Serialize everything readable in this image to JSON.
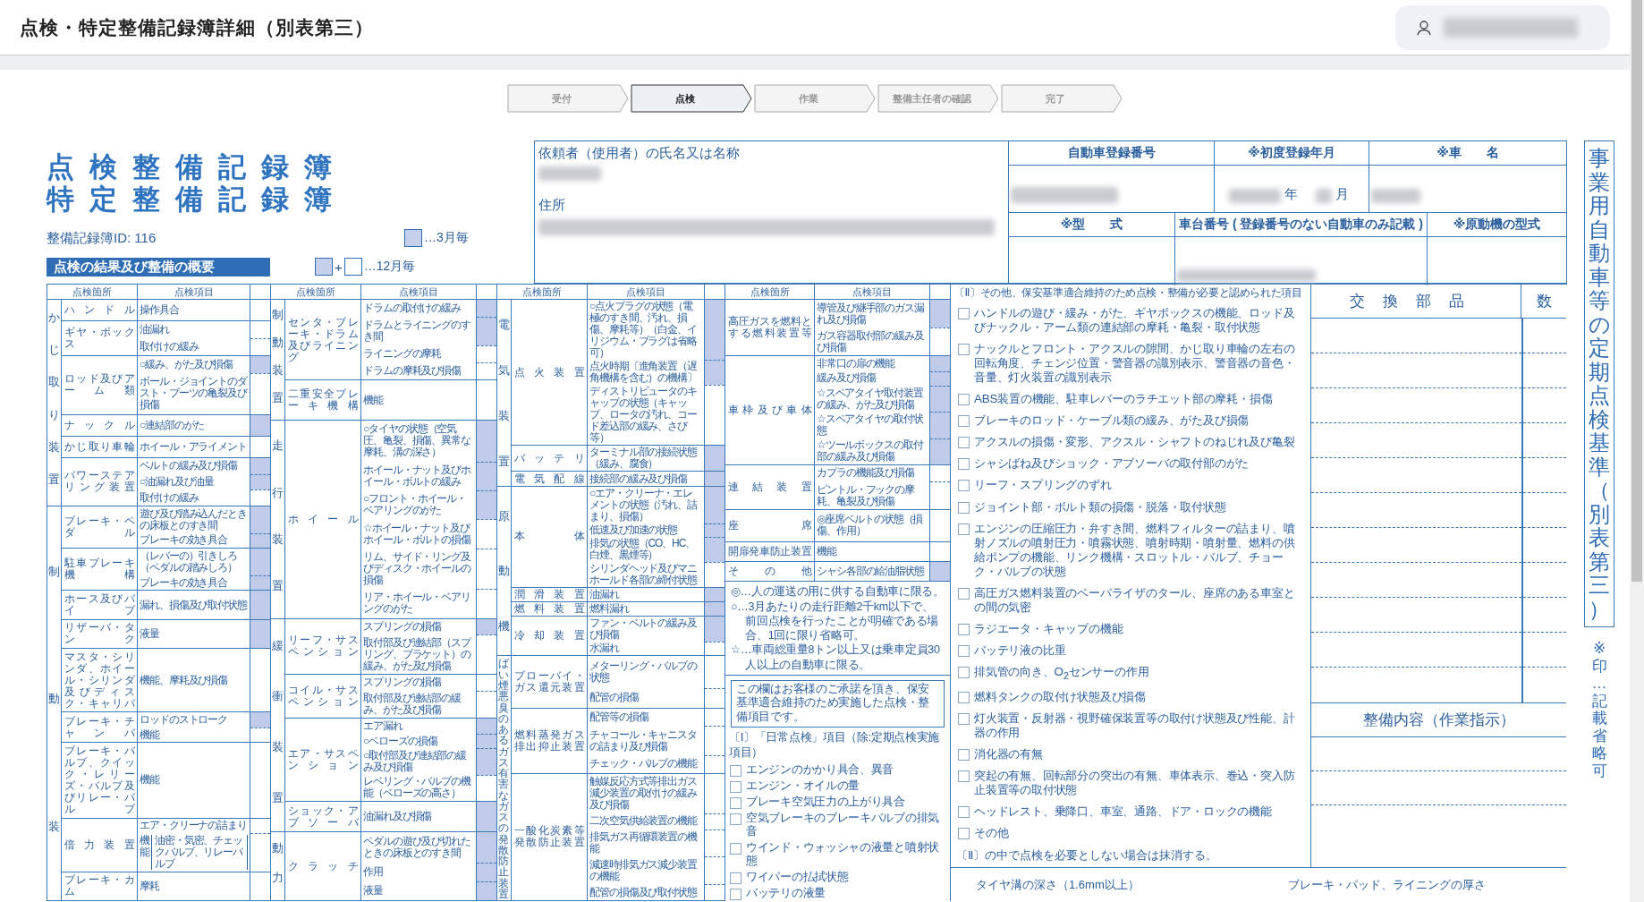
{
  "header": {
    "title": "点検・特定整備記録簿詳細（別表第三）"
  },
  "steps": [
    {
      "label": "受付",
      "selected": false
    },
    {
      "label": "点検",
      "selected": true
    },
    {
      "label": "作業",
      "selected": false
    },
    {
      "label": "整備主任者の確認",
      "selected": false
    },
    {
      "label": "完了",
      "selected": false
    }
  ],
  "form": {
    "titles": [
      "点検整備記録簿",
      "特定整備記録簿"
    ],
    "record_id": "整備記録簿ID: 116",
    "summary_label": "点検の結果及び整備の概要",
    "legend": [
      {
        "kind": "three_month",
        "text": "…3月毎"
      },
      {
        "kind": "twelve_month",
        "plus": "+",
        "text": "…12月毎"
      }
    ],
    "client": {
      "name_label": "依頼者（使用者）の氏名又は名称",
      "address_label": "住所"
    },
    "vehicle": {
      "registration_label": "自動車登録番号",
      "first_registration_label": "※初度登録年月",
      "year": "年",
      "month": "月",
      "car_name_label": "※車　　名",
      "model_label": "※型　　式",
      "chassis_label": "車台番号 ( 登録番号のない自動車のみ記載 )",
      "engine_label": "※原動機の型式"
    },
    "side_title": "事業用自動車等の定期点検基準（別表第三）",
    "side_note": "※印…記載省略可"
  },
  "inspection": {
    "columns": [
      {
        "headers": [
          "点検箇所",
          "点検項目"
        ],
        "categories": [
          {
            "label": "かじ取り装置",
            "parts": [
              {
                "name": "ハンドル",
                "items": [
                  {
                    "text": "操作具合",
                    "shaded": false
                  }
                ]
              },
              {
                "name": "ギヤ・ボックス",
                "items": [
                  {
                    "text": "油漏れ",
                    "shaded": false
                  },
                  {
                    "text": "取付けの緩み",
                    "shaded": false
                  }
                ]
              },
              {
                "name": "ロッド及びアーム類",
                "items": [
                  {
                    "text": "○緩み、がた及び損傷",
                    "shaded": true
                  },
                  {
                    "text": "ボール・ジョイントのダスト・ブーツの亀裂及び損傷",
                    "shaded": false
                  }
                ]
              },
              {
                "name": "ナックル",
                "items": [
                  {
                    "text": "○連結部のがた",
                    "shaded": true
                  }
                ]
              },
              {
                "name": "かじ取り車輪",
                "items": [
                  {
                    "text": "ホイール・アライメント",
                    "shaded": false
                  }
                ]
              },
              {
                "name": "パワーステアリング装置",
                "items": [
                  {
                    "text": "ベルトの緩み及び損傷",
                    "shaded": true
                  },
                  {
                    "text": "○油漏れ及び油量",
                    "shaded": true
                  },
                  {
                    "text": "取付けの緩み",
                    "shaded": false
                  }
                ]
              }
            ]
          },
          {
            "label": "制動装",
            "parts": [
              {
                "name": "ブレーキ・ペダル",
                "items": [
                  {
                    "text": "遊び及び踏み込んだときの床板とのすき間",
                    "shaded": true
                  },
                  {
                    "text": "ブレーキの効き具合",
                    "shaded": true
                  }
                ]
              },
              {
                "name": "駐車ブレーキ機構",
                "items": [
                  {
                    "text": "（レバーの）引きしろ（ペダルの踏みしろ）",
                    "shaded": true
                  },
                  {
                    "text": "ブレーキの効き具合",
                    "shaded": true
                  }
                ]
              },
              {
                "name": "ホース及びパイプ",
                "items": [
                  {
                    "text": "漏れ、損傷及び取付状態",
                    "shaded": true
                  }
                ]
              },
              {
                "name": "リザーバ・タンク",
                "items": [
                  {
                    "text": "液量",
                    "shaded": true
                  }
                ]
              },
              {
                "name": "マスタ・シリンダ、ホイール・シリンダ及びディスク・キャリパ",
                "items": [
                  {
                    "text": "機能、摩耗及び損傷",
                    "shaded": false
                  }
                ]
              },
              {
                "name": "ブレーキ・チャンバ",
                "items": [
                  {
                    "text": "ロッドのストローク",
                    "shaded": true
                  },
                  {
                    "text": "機能",
                    "shaded": false
                  }
                ]
              },
              {
                "name": "ブレーキ・バルブ、クイック・レリーズ・バルブ及びリレー・バルブ",
                "items": [
                  {
                    "text": "機能",
                    "shaded": false
                  }
                ]
              },
              {
                "name": "倍力装置",
                "items": [
                  {
                    "text": "エア・クリーナの詰まり",
                    "shaded": false
                  },
                  {
                    "text": "機能",
                    "note": "油密・気密、チェックバルブ、リレーバルブ",
                    "shaded": false
                  }
                ]
              },
              {
                "name": "ブレーキ・カム",
                "items": [
                  {
                    "text": "摩耗",
                    "shaded": false
                  }
                ]
              }
            ]
          }
        ]
      },
      {
        "headers": [
          "点検箇所",
          "点検項目"
        ],
        "categories": [
          {
            "label": "制動装置",
            "parts": [
              {
                "name": "センタ・ブレーキ・ドラム及びライニング",
                "items": [
                  {
                    "text": "ドラムの取付けの緩み",
                    "shaded": true
                  },
                  {
                    "text": "ドラムとライニングのすき間",
                    "shaded": true
                  },
                  {
                    "text": "ライニングの摩耗",
                    "shaded": false
                  },
                  {
                    "text": "ドラムの摩耗及び損傷",
                    "shaded": false
                  }
                ]
              },
              {
                "name": "二重安全ブレーキ機構",
                "items": [
                  {
                    "text": "機能",
                    "shaded": false
                  }
                ]
              }
            ]
          },
          {
            "label": "走行装置",
            "parts": [
              {
                "name": "ホイール",
                "items": [
                  {
                    "text": "○タイヤの状態（空気圧、亀裂、損傷、異常な摩耗、溝の深さ）",
                    "shaded": true
                  },
                  {
                    "text": "ホイール・ナット及びホイール・ボルトの緩み",
                    "shaded": true
                  },
                  {
                    "text": "○フロント・ホイール・ベアリングのがた",
                    "shaded": true
                  },
                  {
                    "text": "☆ホイール・ナット及びホイール・ボルトの損傷",
                    "shaded": false
                  },
                  {
                    "text": "リム、サイド・リング及びディスク・ホイールの損傷",
                    "shaded": false
                  },
                  {
                    "text": "リア・ホイール・ベアリングのがた",
                    "shaded": false
                  }
                ]
              }
            ]
          },
          {
            "label": "緩衝装置",
            "parts": [
              {
                "name": "リーフ・サスペンション",
                "items": [
                  {
                    "text": "スプリングの損傷",
                    "shaded": true
                  },
                  {
                    "text": "取付部及び連結部（スプリング、ブラケット）の緩み、がた及び損傷",
                    "shaded": false
                  }
                ]
              },
              {
                "name": "コイル・サスペンション",
                "items": [
                  {
                    "text": "スプリングの損傷",
                    "shaded": false
                  },
                  {
                    "text": "取付部及び連結部の緩み、がた及び損傷",
                    "shaded": false
                  }
                ]
              },
              {
                "name": "エア・サスペンション",
                "items": [
                  {
                    "text": "エア漏れ",
                    "shaded": true
                  },
                  {
                    "text": "○ベローズの損傷",
                    "shaded": true
                  },
                  {
                    "text": "○取付部及び連結部の緩み及び損傷",
                    "shaded": true
                  },
                  {
                    "text": "レベリング・バルブの機能（ベローズの高さ）",
                    "shaded": false
                  }
                ]
              },
              {
                "name": "ショック・アブソーバ",
                "items": [
                  {
                    "text": "油漏れ及び損傷",
                    "shaded": true
                  }
                ]
              }
            ]
          },
          {
            "label": "動力",
            "parts": [
              {
                "name": "クラッチ",
                "items": [
                  {
                    "text": "ペダルの遊び及び切れたときの床板とのすき間",
                    "shaded": true
                  },
                  {
                    "text": "作用",
                    "shaded": true
                  },
                  {
                    "text": "液量",
                    "shaded": true
                  }
                ]
              }
            ]
          }
        ]
      },
      {
        "headers": [
          "点検箇所",
          "点検項目"
        ],
        "categories": [
          {
            "label": "電気装置",
            "parts": [
              {
                "name": "点火装置",
                "items": [
                  {
                    "text": "○点火プラグの状態（電極のすき間、汚れ、損傷、摩耗等）（白金、イリジウム・プラグは省略可）",
                    "shaded": true
                  },
                  {
                    "text": "点火時期〔進角装置（遅角機構を含む）の機構〕",
                    "shaded": true
                  },
                  {
                    "text": "ディストリビュータのキャップの状態（キャップ、ロータの汚れ、コード差込部の緩み、さび等）",
                    "shaded": false
                  }
                ]
              },
              {
                "name": "バッテリ",
                "items": [
                  {
                    "text": "ターミナル部の接続状態（緩み、腐食）",
                    "shaded": true
                  }
                ]
              },
              {
                "name": "電気配線",
                "items": [
                  {
                    "text": "接続部の緩み及び損傷",
                    "shaded": true
                  }
                ]
              }
            ]
          },
          {
            "label": "原動機",
            "parts": [
              {
                "name": "本体",
                "items": [
                  {
                    "text": "○エア・クリーナ・エレメントの状態（汚れ、詰まり、損傷）",
                    "shaded": true
                  },
                  {
                    "text": "低速及び加速の状態",
                    "shaded": true
                  },
                  {
                    "text": "排気の状態（CO、HC、白煙、黒煙等）",
                    "shaded": true
                  },
                  {
                    "text": "シリンダヘッド及びマニホールド各部の締付状態",
                    "shaded": false
                  }
                ]
              },
              {
                "name": "潤滑装置",
                "items": [
                  {
                    "text": "油漏れ",
                    "shaded": true
                  }
                ]
              },
              {
                "name": "燃料装置",
                "items": [
                  {
                    "text": "燃料漏れ",
                    "shaded": true
                  }
                ]
              },
              {
                "name": "冷却装置",
                "items": [
                  {
                    "text": "ファン・ベルトの緩み及び損傷",
                    "shaded": true
                  },
                  {
                    "text": "水漏れ",
                    "shaded": false
                  }
                ]
              }
            ]
          },
          {
            "label": "ばい煙悪臭のあるガス有害なガスの発散防止装置",
            "parts": [
              {
                "name": "ブローバイ・ガス還元装置",
                "items": [
                  {
                    "text": "メターリング・バルブの状態",
                    "shaded": false
                  },
                  {
                    "text": "配管の損傷",
                    "shaded": false
                  }
                ]
              },
              {
                "name": "燃料蒸発ガス排出抑止装置",
                "items": [
                  {
                    "text": "配管等の損傷",
                    "shaded": false
                  },
                  {
                    "text": "チャコール・キャニスタの詰まり及び損傷",
                    "shaded": false
                  },
                  {
                    "text": "チェック・バルブの機能",
                    "shaded": false
                  }
                ]
              },
              {
                "name": "一酸化炭素等発散防止装置",
                "items": [
                  {
                    "text": "触媒反応方式等排出ガス減少装置の取付けの緩み及び損傷",
                    "shaded": false
                  },
                  {
                    "text": "二次空気供給装置の機能",
                    "shaded": false
                  },
                  {
                    "text": "排気ガス再循環装置の機能",
                    "shaded": false
                  },
                  {
                    "text": "減速時排気ガス減少装置の機能",
                    "shaded": false
                  },
                  {
                    "text": "配管の損傷及び取付状態",
                    "shaded": false
                  }
                ]
              }
            ]
          }
        ]
      },
      {
        "headers": [
          "点検箇所",
          "点検項目"
        ],
        "parts": [
          {
            "name": "高圧ガスを燃料とする燃料装置等",
            "items": [
              {
                "text": "導管及び継手部のガス漏れ及び損傷",
                "shaded": true
              },
              {
                "text": "ガス容器取付部の緩み及び損傷",
                "shaded": false
              }
            ]
          },
          {
            "name": "車枠及び車体",
            "items": [
              {
                "text": "非常口の扉の機能",
                "shaded": true
              },
              {
                "text": "緩み及び損傷",
                "shaded": true
              },
              {
                "text": "☆スペアタイヤ取付装置の緩み、がた及び損傷",
                "shaded": true
              },
              {
                "text": "☆スペアタイヤの取付状態",
                "shaded": true
              },
              {
                "text": "☆ツールボックスの取付部の緩み及び損傷",
                "shaded": true
              }
            ]
          },
          {
            "name": "連結装置",
            "items": [
              {
                "text": "カプラの機能及び損傷",
                "shaded": false
              },
              {
                "text": "ピントル・フックの摩耗、亀裂及び損傷",
                "shaded": false
              }
            ]
          },
          {
            "name": "座席",
            "items": [
              {
                "text": "◎座席ベルトの状態（損傷、作用）",
                "shaded": false
              }
            ]
          },
          {
            "name": "開扉発車防止装置",
            "items": [
              {
                "text": "機能",
                "shaded": false
              }
            ]
          },
          {
            "name": "その他",
            "items": [
              {
                "text": "シャシ各部の給油脂状態",
                "shaded": true
              }
            ]
          }
        ],
        "notes": [
          "◎…人の運送の用に供する自動車に限る。",
          "○…3月あたりの走行距離2千km以下で、前回点検を行ったことが明確である場合、1回に限り省略可。",
          "☆…車両総重量8トン以上又は乗車定員30人以上の自動車に限る。"
        ],
        "consent_box": "この欄はお客様のご承諾を頂き、保安基準適合維持のため実施した点検・整備項目です。",
        "daily_heading": "〔Ⅰ〕「日常点検」項目（除:定期点検実施項目）",
        "daily_checks": [
          {
            "text": "エンジンのかかり具合、異音",
            "checked": false
          },
          {
            "text": "エンジン・オイルの量",
            "checked": false
          },
          {
            "text": "ブレーキ空気圧力の上がり具合",
            "checked": false
          },
          {
            "text": "空気ブレーキのブレーキバルブの排気音",
            "checked": false
          },
          {
            "text": "ウインド・ウォッシャの液量と噴射状態",
            "checked": false
          },
          {
            "text": "ワイパーの払拭状態",
            "checked": false
          },
          {
            "text": "バッテリの液量",
            "checked": false
          }
        ]
      }
    ]
  },
  "other_checks": {
    "heading": "〔Ⅱ〕その他、保安基準適合維持のため点検・整備が必要と認められた項目",
    "items": [
      {
        "text": "ハンドルの遊び・緩み・がた、ギヤボックスの機能、ロッド及びナックル・アーム類の連結部の摩耗・亀裂・取付状態",
        "checked": false
      },
      {
        "text": "ナックルとフロント・アクスルの隙間、かじ取り車輪の左右の回転角度、チェンジ位置・警音器の識別表示、警音器の音色・音量、灯火装置の識別表示",
        "checked": false
      },
      {
        "text": "ABS装置の機能、駐車レバーのラチエット部の摩耗・損傷",
        "checked": false
      },
      {
        "text": "ブレーキのロッド・ケーブル類の緩み、がた及び損傷",
        "checked": false
      },
      {
        "text": "アクスルの損傷・変形、アクスル・シャフトのねじれ及び亀裂",
        "checked": false
      },
      {
        "text": "シャシばね及びショック・アブソーバの取付部のがた",
        "checked": false
      },
      {
        "text": "リーフ・スプリングのずれ",
        "checked": false
      },
      {
        "text": "ジョイント部・ボルト類の損傷・脱落・取付状態",
        "checked": false
      },
      {
        "text": "エンジンの圧縮圧力・弁すき間、燃料フィルターの詰まり、噴射ノズルの噴射圧力・噴霧状態、噴射時期・噴射量、燃料の供給ポンプの機能、リンク機構・スロットル・バルブ、チョーク・バルブの状態",
        "checked": false
      },
      {
        "text": "高圧ガス燃料装置のベーパライザのタール、座席のある車室との間の気密",
        "checked": false
      },
      {
        "text": "ラジエータ・キャップの機能",
        "checked": false
      },
      {
        "text": "バッテリ液の比重",
        "checked": false
      },
      {
        "text": "排気管の向き、O$_{2}$センサーの作用",
        "checked": false
      },
      {
        "text": "燃料タンクの取付け状態及び損傷",
        "checked": false
      },
      {
        "text": "灯火装置・反射器・視野確保装置等の取付け状態及び性能、計器の作用",
        "checked": false
      },
      {
        "text": "消化器の有無",
        "checked": false
      },
      {
        "text": "突起の有無、回転部分の突出の有無、車体表示、巻込・突入防止装置等の取付状態",
        "checked": false
      },
      {
        "text": "ヘッドレスト、乗降口、車室、通路、ドア・ロックの機能",
        "checked": false
      },
      {
        "text": "その他",
        "checked": false
      }
    ],
    "footer": "〔Ⅱ〕の中で点検を必要としない場合は抹消する。"
  },
  "parts_table": {
    "headers": [
      "交換部品",
      "数"
    ],
    "work_header": "整備内容（作業指示）"
  },
  "measurements": [
    "タイヤ溝の深さ（1.6mm以上）",
    "ブレーキ・パッド、ライニングの厚さ"
  ]
}
